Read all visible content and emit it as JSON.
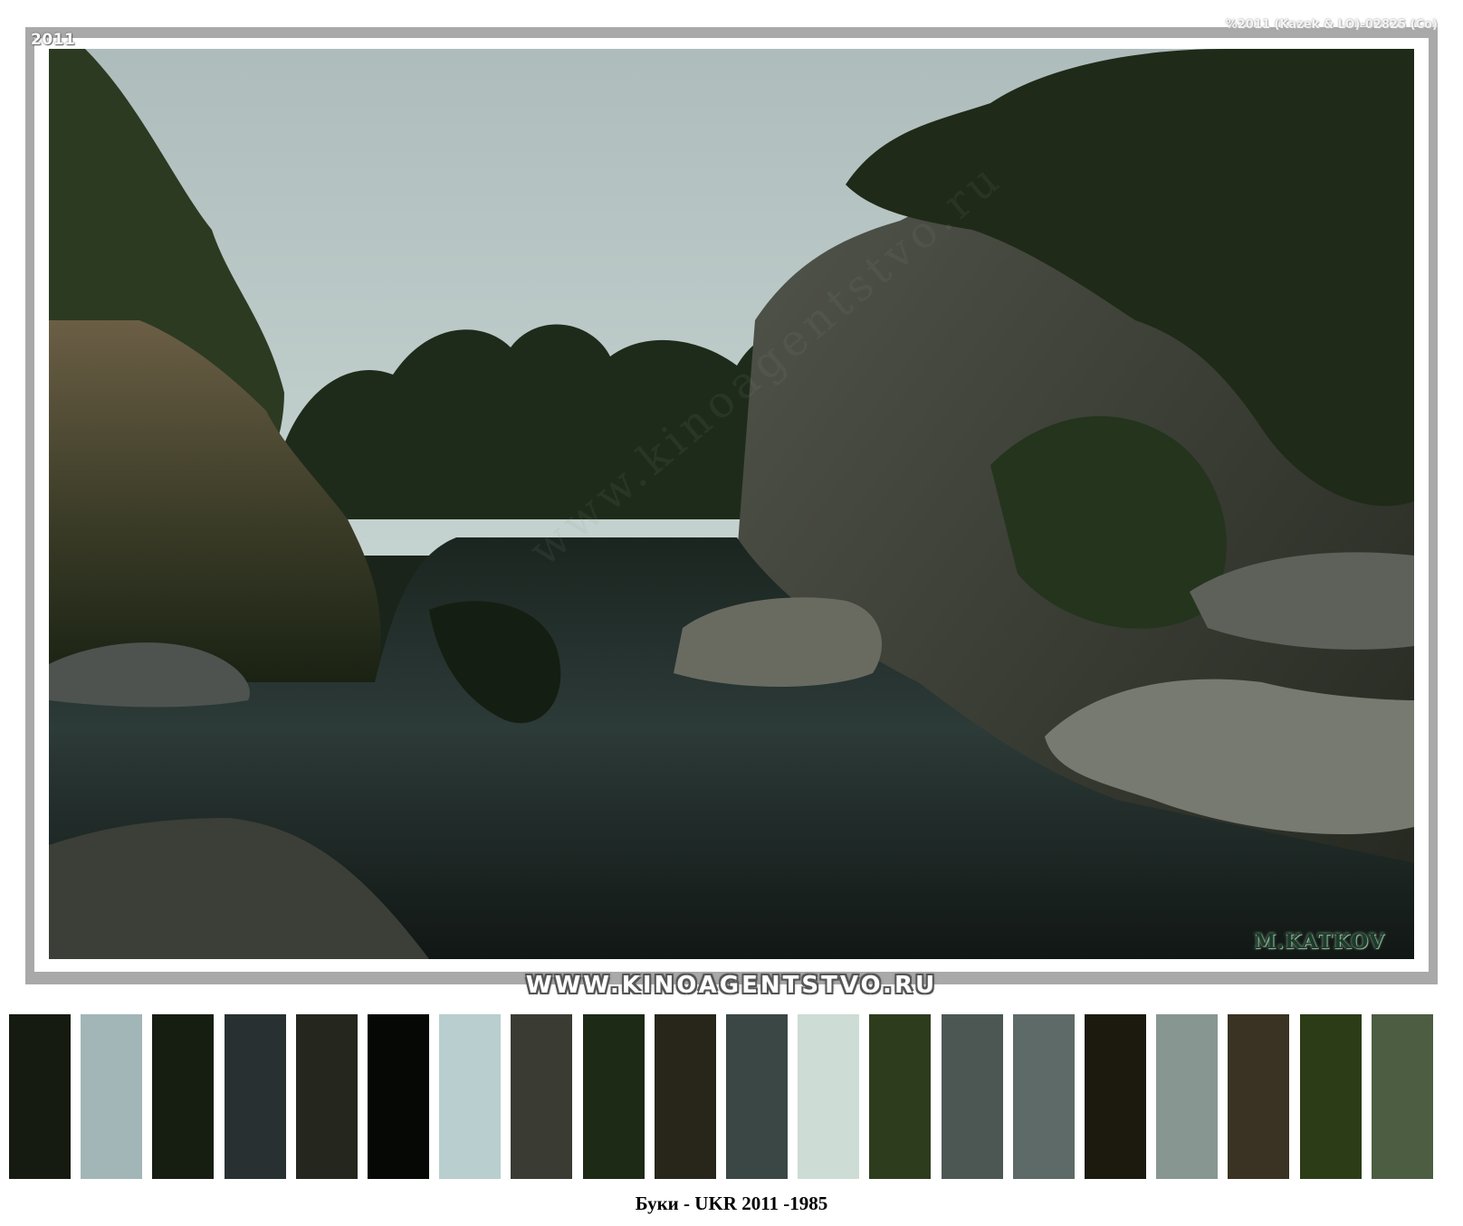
{
  "photo": {
    "year_tag": "2011",
    "copyright": "%2011 (Kazek & LO)-02825 (Co)",
    "signature": "M.KATKOV",
    "watermark": "www.kinoagentstvo.ru"
  },
  "banner": {
    "site": "WWW.KINOAGENTSTVO.RU"
  },
  "palette": {
    "colors": [
      "#161b12",
      "#a3b6b7",
      "#161e12",
      "#283032",
      "#25271f",
      "#050804",
      "#b8cecf",
      "#3a3b32",
      "#1c2a16",
      "#28261a",
      "#3b4745",
      "#cddcd5",
      "#2e3c1e",
      "#4c5754",
      "#5e6a68",
      "#1c1a0f",
      "#889692",
      "#3a3222",
      "#2c3c17",
      "#4c5d41"
    ]
  },
  "caption": "Буки - UKR 2011 -1985"
}
